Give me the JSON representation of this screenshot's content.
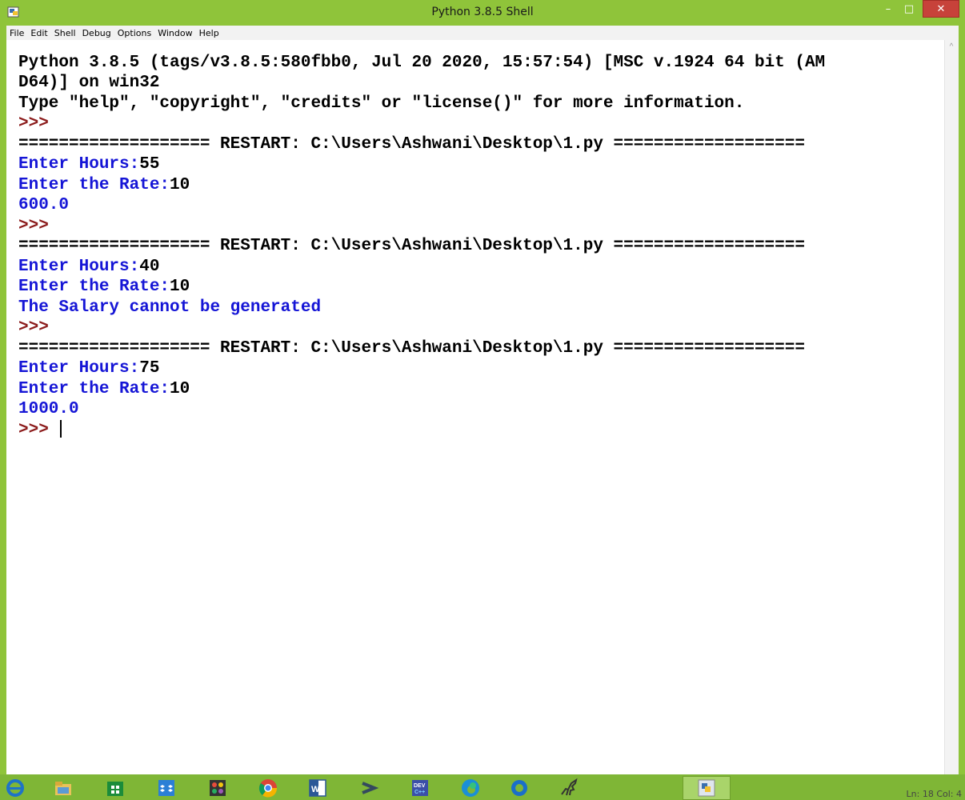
{
  "window": {
    "title": "Python 3.8.5 Shell",
    "controls": {
      "minimize": "–",
      "maximize": "□",
      "close": "✕"
    }
  },
  "menu": [
    "File",
    "Edit",
    "Shell",
    "Debug",
    "Options",
    "Window",
    "Help"
  ],
  "shell": {
    "banner": [
      "Python 3.8.5 (tags/v3.8.5:580fbb0, Jul 20 2020, 15:57:54) [MSC v.1924 64 bit (AM",
      "D64)] on win32",
      "Type \"help\", \"copyright\", \"credits\" or \"license()\" for more information."
    ],
    "prompt": ">>>",
    "restart": "=================== RESTART: C:\\Users\\Ashwani\\Desktop\\1.py ===================",
    "runs": [
      {
        "hours_prompt": "Enter Hours:",
        "hours": "55",
        "rate_prompt": "Enter the Rate:",
        "rate": "10",
        "output": "600.0"
      },
      {
        "hours_prompt": "Enter Hours:",
        "hours": "40",
        "rate_prompt": "Enter the Rate:",
        "rate": "10",
        "output": "The Salary cannot be generated"
      },
      {
        "hours_prompt": "Enter Hours:",
        "hours": "75",
        "rate_prompt": "Enter the Rate:",
        "rate": "10",
        "output": "1000.0"
      }
    ]
  },
  "statusbar": {
    "position": "Ln: 18   Col: 4"
  },
  "taskbar": {
    "icons": [
      "internet-explorer-icon",
      "file-explorer-icon",
      "store-icon",
      "dropbox-icon",
      "paint-icon",
      "chrome-icon",
      "word-icon",
      "terminal-icon",
      "dev-cpp-icon",
      "edge-icon",
      "cortana-icon",
      "dinosaur-app-icon",
      "python-idle-icon"
    ]
  },
  "colors": {
    "frame": "#8fc43a",
    "output_blue": "#1515d6",
    "prompt_red": "#8b1a1a",
    "close_red": "#c7423a"
  }
}
